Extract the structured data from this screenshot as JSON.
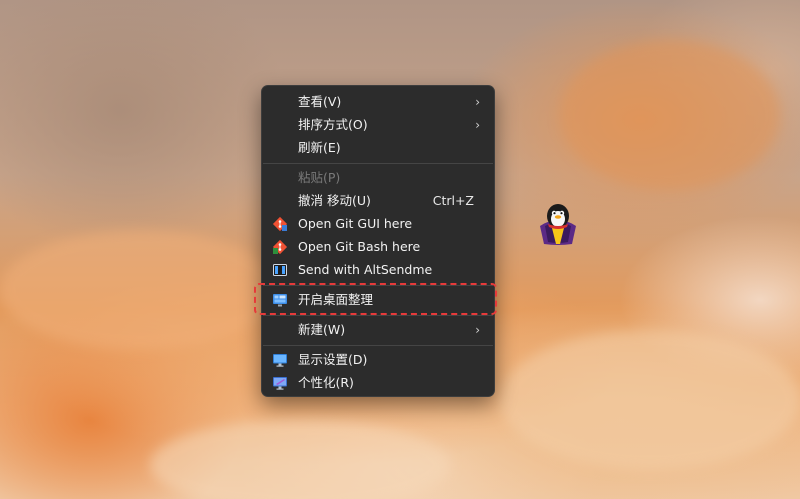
{
  "desktop": {
    "background": "orange-cat-wallpaper",
    "widget_icon": "penguin-icon"
  },
  "context_menu": {
    "items": [
      {
        "label": "查看(V)",
        "submenu": true
      },
      {
        "label": "排序方式(O)",
        "submenu": true
      },
      {
        "label": "刷新(E)"
      },
      {
        "label": "粘贴(P)",
        "disabled": true
      },
      {
        "label": "撤消 移动(U)",
        "shortcut": "Ctrl+Z"
      },
      {
        "label": "Open Git GUI here",
        "icon": "git-gui-icon"
      },
      {
        "label": "Open Git Bash here",
        "icon": "git-bash-icon"
      },
      {
        "label": "Send with AltSendme",
        "icon": "altsendme-icon"
      },
      {
        "label": "开启桌面整理",
        "icon": "desktop-organize-icon",
        "highlighted": true
      },
      {
        "label": "新建(W)",
        "submenu": true
      },
      {
        "label": "显示设置(D)",
        "icon": "display-settings-icon"
      },
      {
        "label": "个性化(R)",
        "icon": "personalize-icon"
      }
    ],
    "submenu_glyph": "›"
  },
  "colors": {
    "menu_bg": "#2c2c2c",
    "text": "#f2f2f2",
    "disabled_text": "#7a7a7a",
    "highlight_border": "#e63a3a",
    "git_orange": "#f05133"
  }
}
